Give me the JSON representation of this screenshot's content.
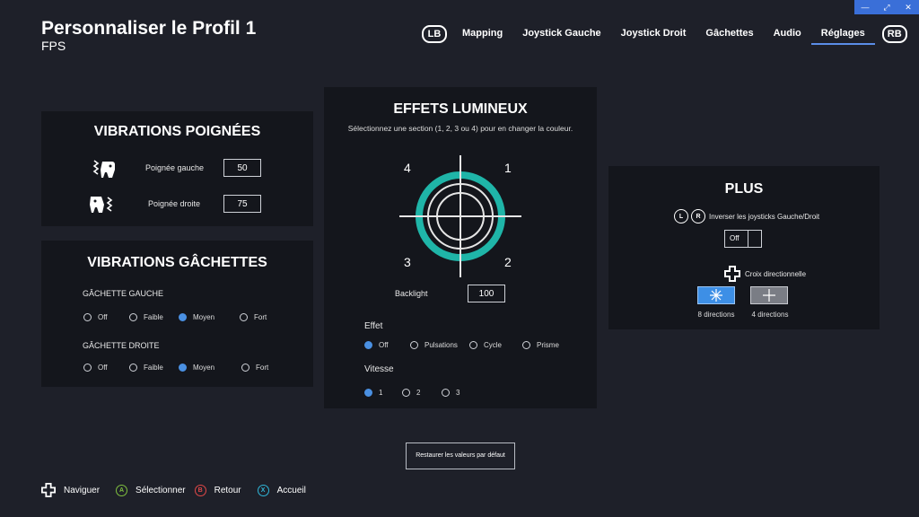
{
  "window": {
    "controls": [
      "—",
      "⤢",
      "✕"
    ]
  },
  "header": {
    "title": "Personnaliser le Profil 1",
    "subtitle": "FPS",
    "lb": "LB",
    "rb": "RB",
    "tabs": [
      "Mapping",
      "Joystick Gauche",
      "Joystick Droit",
      "Gâchettes",
      "Audio",
      "Réglages"
    ],
    "active_tab": "Réglages"
  },
  "vib_poignees": {
    "title": "VIBRATIONS POIGNÉES",
    "left_label": "Poignée gauche",
    "left_value": "50",
    "right_label": "Poignée droite",
    "right_value": "75"
  },
  "vib_gachettes": {
    "title": "VIBRATIONS GÂCHETTES",
    "left_label": "GÂCHETTE GAUCHE",
    "right_label": "GÂCHETTE DROITE",
    "options": [
      "Off",
      "Faible",
      "Moyen",
      "Fort"
    ],
    "left_selected": "Moyen",
    "right_selected": "Moyen"
  },
  "effets": {
    "title": "EFFETS LUMINEUX",
    "instruction": "Sélectionnez une section (1, 2, 3 ou 4) pour en changer la couleur.",
    "q1": "1",
    "q2": "2",
    "q3": "3",
    "q4": "4",
    "ring_color": "#1fb5a8",
    "backlight_label": "Backlight",
    "backlight_value": "100",
    "effet_label": "Effet",
    "effet_options": [
      "Off",
      "Pulsations",
      "Cycle",
      "Prisme"
    ],
    "effet_selected": "Off",
    "vitesse_label": "Vitesse",
    "vitesse_options": [
      "1",
      "2",
      "3"
    ],
    "vitesse_selected": "1"
  },
  "plus": {
    "title": "PLUS",
    "l_btn": "L",
    "r_btn": "R",
    "invert_label": "Inverser les joysticks Gauche/Droit",
    "invert_value": "Off",
    "dpad_label": "Croix directionnelle",
    "dir8_label": "8 directions",
    "dir4_label": "4 directions",
    "dir8_selected": true,
    "accent": "#3d8fe6"
  },
  "reset_label": "Restaurer les valeurs par défaut",
  "footer": {
    "navigate": "Naviguer",
    "a_btn": "A",
    "select": "Sélectionner",
    "b_btn": "B",
    "back": "Retour",
    "x_btn": "X",
    "home": "Accueil",
    "a_color": "#7fbf3f",
    "b_color": "#e04848",
    "x_color": "#2fb6d8"
  }
}
